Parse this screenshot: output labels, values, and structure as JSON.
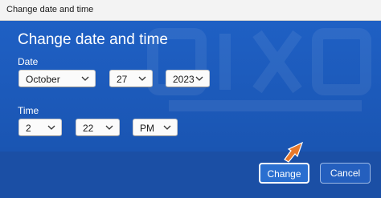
{
  "window": {
    "title": "Change date and time"
  },
  "dialog": {
    "heading": "Change date and time",
    "date_label": "Date",
    "time_label": "Time",
    "date": {
      "month": "October",
      "day": "27",
      "year": "2023"
    },
    "time": {
      "hour": "2",
      "minute": "22",
      "period": "PM"
    }
  },
  "buttons": {
    "change": "Change",
    "cancel": "Cancel"
  },
  "colors": {
    "background": "#1f56ac",
    "accent_pointer": "#e8792b",
    "field_bg": "#fbfbfb"
  },
  "icons": {
    "dropdown": "chevron-down-icon",
    "pointer": "arrow-pointer-icon"
  }
}
